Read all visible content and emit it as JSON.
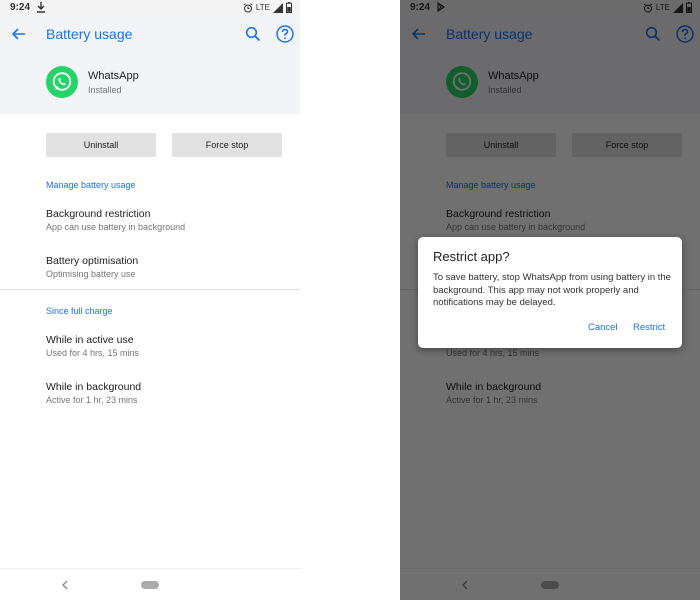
{
  "colors": {
    "accent": "#1a73e8",
    "whatsapp_green": "#25d366",
    "header_bg": "#f3f4f8",
    "button_bg": "#e1e1e1"
  },
  "status_bar": {
    "time": "9:24",
    "network": "LTE",
    "left_icon": "download-icon",
    "right_icon_left_phone": "download-icon",
    "right_icon_right_phone": "play-store-icon",
    "icons": [
      "alarm-icon",
      "signal-icon",
      "battery-icon"
    ]
  },
  "header": {
    "title": "Battery usage",
    "back_icon": "back-arrow-icon",
    "search_icon": "search-icon",
    "help_icon": "help-icon"
  },
  "app": {
    "name": "WhatsApp",
    "status": "Installed",
    "icon": "whatsapp-icon"
  },
  "buttons": {
    "uninstall": "Uninstall",
    "force_stop": "Force stop"
  },
  "sections": {
    "manage": {
      "label": "Manage battery usage",
      "items": [
        {
          "title": "Background restriction",
          "subtitle": "App can use battery in background"
        },
        {
          "title": "Battery optimisation",
          "subtitle": "Optimising battery use"
        }
      ]
    },
    "since_charge": {
      "label": "Since full charge",
      "items": [
        {
          "title": "While in active use",
          "subtitle": "Used for 4 hrs, 15 mins"
        },
        {
          "title": "While in background",
          "subtitle": "Active for 1 hr, 23 mins"
        }
      ]
    }
  },
  "dialog": {
    "title": "Restrict app?",
    "message": "To save battery, stop WhatsApp from using battery in the background. This app may not work properly and notifications may be delayed.",
    "cancel": "Cancel",
    "restrict": "Restrict"
  }
}
